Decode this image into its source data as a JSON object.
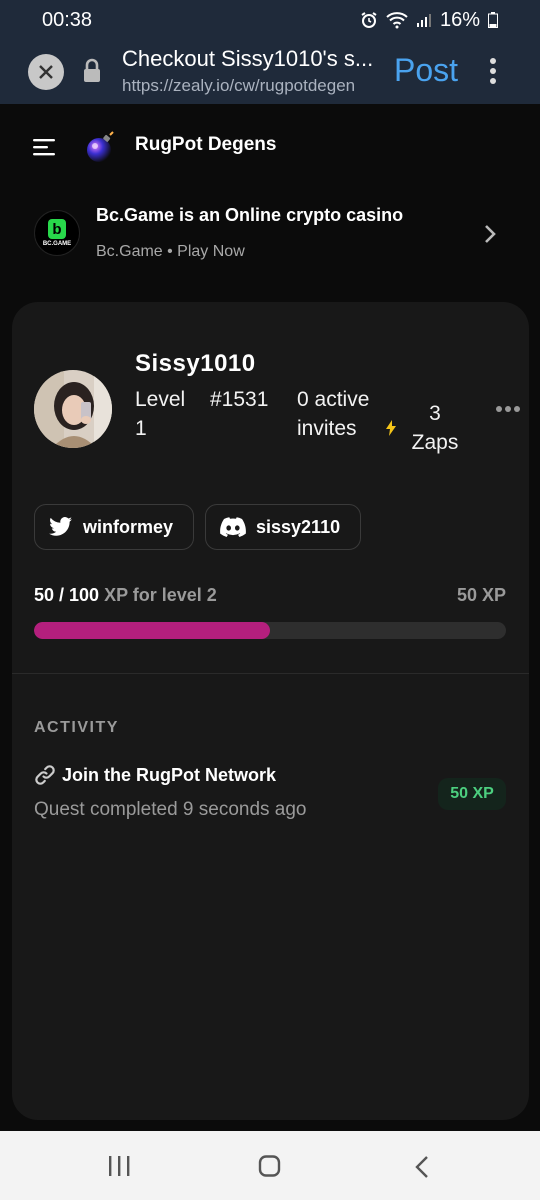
{
  "status_bar": {
    "time": "00:38",
    "battery": "16%"
  },
  "browser": {
    "title": "Checkout Sissy1010's s...",
    "url": "https://zealy.io/cw/rugpotdegen",
    "post_label": "Post"
  },
  "app": {
    "community_name": "RugPot Degens"
  },
  "ad": {
    "title": "Bc.Game is an Online crypto casino",
    "subtitle": "Bc.Game • Play Now",
    "logo_letter": "b",
    "logo_text": "BC.GAME"
  },
  "profile": {
    "username": "Sissy1010",
    "level": "Level 1",
    "rank": "#1531",
    "invites": "0 active invites",
    "zaps": "3 Zaps",
    "twitter": "winformey",
    "discord": "sissy2110",
    "xp_current_label": "50 / 100",
    "xp_next_label": "XP for level 2",
    "xp_remaining": "50 XP",
    "xp_progress": 0.5,
    "accent_color": "#b41f7d"
  },
  "activity": {
    "heading": "ACTIVITY",
    "items": [
      {
        "icon": "link-icon",
        "title": "Join the RugPot Network",
        "subtitle": "Quest completed 9 seconds ago",
        "xp": "50 XP"
      }
    ]
  }
}
